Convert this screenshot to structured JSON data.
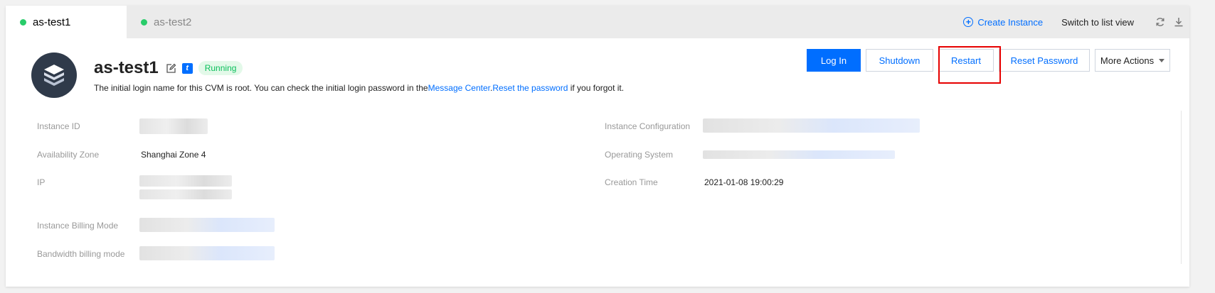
{
  "tabs": [
    {
      "label": "as-test1",
      "active": true
    },
    {
      "label": "as-test2",
      "active": false
    }
  ],
  "toolbar": {
    "create_instance": "Create Instance",
    "switch_view": "Switch to list view",
    "refresh_icon": "refresh-icon",
    "download_icon": "download-icon"
  },
  "instance": {
    "name": "as-test1",
    "status": "Running",
    "hint_prefix": "The initial login name for this CVM is root. You can check the initial login password in the",
    "hint_link1": "Message Center",
    "hint_sep": ".",
    "hint_link2": "Reset the password",
    "hint_suffix": " if you forgot it."
  },
  "actions": {
    "login": "Log In",
    "shutdown": "Shutdown",
    "restart": "Restart",
    "reset_password": "Reset Password",
    "more_actions": "More Actions"
  },
  "fields": {
    "instance_id": {
      "label": "Instance ID"
    },
    "availability_zone": {
      "label": "Availability Zone",
      "value": "Shanghai Zone 4"
    },
    "ip": {
      "label": "IP"
    },
    "billing_mode": {
      "label": "Instance Billing Mode"
    },
    "bandwidth_mode": {
      "label": "Bandwidth billing mode"
    },
    "instance_config": {
      "label": "Instance Configuration"
    },
    "os": {
      "label": "Operating System"
    },
    "creation_time": {
      "label": "Creation Time",
      "value": "2021-01-08 19:00:29"
    }
  },
  "colors": {
    "accent": "#006eff",
    "running_green": "#0abf5b",
    "highlight_red": "#e60000"
  }
}
